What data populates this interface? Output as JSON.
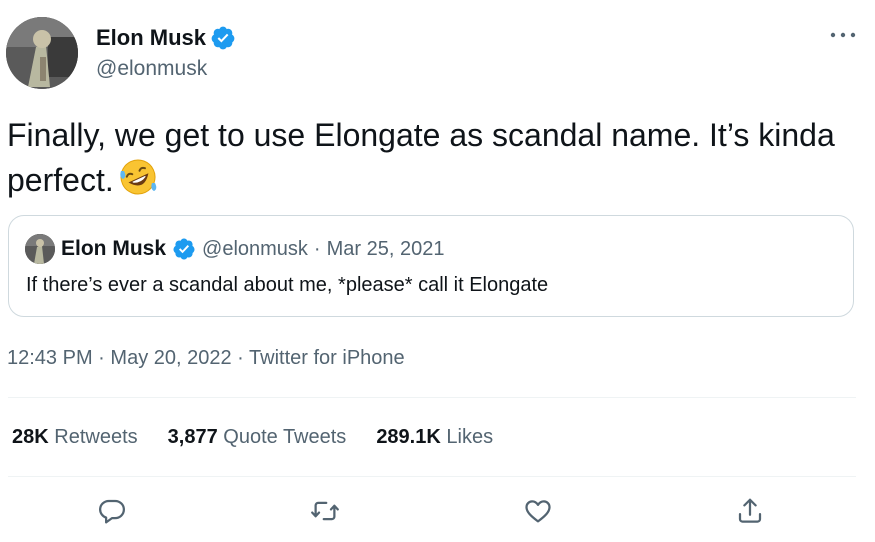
{
  "author": {
    "name": "Elon Musk",
    "handle": "@elonmusk"
  },
  "tweet": {
    "text": "Finally, we get to use Elongate as scandal name. It’s kinda perfect."
  },
  "quote": {
    "name": "Elon Musk",
    "handle": "@elonmusk",
    "separator": "·",
    "date": "Mar 25, 2021",
    "text": "If there’s ever a scandal about me, *please* call it Elongate"
  },
  "meta": {
    "time": "12:43 PM",
    "separator": "·",
    "date": "May 20, 2022",
    "source": "Twitter for iPhone"
  },
  "stats": {
    "retweets_count": "28K",
    "retweets_label": "Retweets",
    "quotes_count": "3,877",
    "quotes_label": "Quote Tweets",
    "likes_count": "289.1K",
    "likes_label": "Likes"
  },
  "colors": {
    "verified_blue": "#1d9bf0",
    "secondary_text": "#536471",
    "border": "#cfd9de"
  },
  "icons": {
    "more": "more-horizontal-icon",
    "reply": "reply-bubble-icon",
    "retweet": "retweet-arrows-icon",
    "like": "heart-icon",
    "share": "share-upload-icon",
    "emoji": "rolling-on-floor-laughing-emoji"
  }
}
